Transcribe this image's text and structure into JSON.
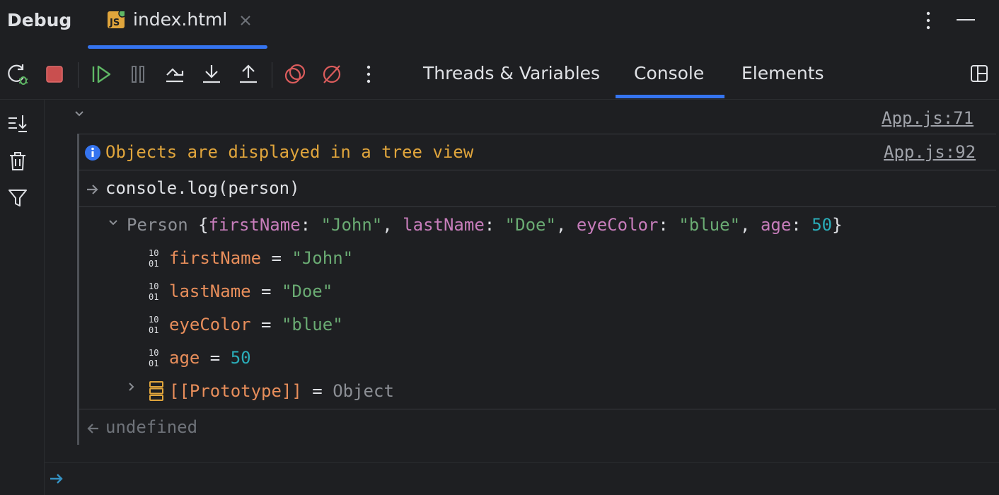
{
  "window": {
    "title": "Debug",
    "file_tab": {
      "label": "index.html",
      "icon": "js-file-icon"
    }
  },
  "toolbar": {
    "buttons": [
      {
        "name": "rerun-debug-icon"
      },
      {
        "name": "stop-icon",
        "color": "#db5c5c"
      },
      {
        "name": "resume-icon",
        "color": "#5fb865"
      },
      {
        "name": "pause-icon"
      },
      {
        "name": "step-over-icon"
      },
      {
        "name": "step-into-icon"
      },
      {
        "name": "step-out-icon"
      },
      {
        "name": "view-breakpoints-icon",
        "color": "#db5c5c"
      },
      {
        "name": "mute-breakpoints-icon",
        "color": "#db5c5c"
      },
      {
        "name": "more-icon"
      }
    ],
    "tabs": [
      {
        "label": "Threads & Variables",
        "active": false
      },
      {
        "label": "Console",
        "active": true
      },
      {
        "label": "Elements",
        "active": false
      }
    ],
    "accent": "#3574f0"
  },
  "gutter": {
    "buttons": [
      "scroll-to-end-icon",
      "clear-all-icon",
      "filter-icon"
    ]
  },
  "console": {
    "group_source": "App.js:71",
    "info": {
      "text": "Objects are displayed in a tree view",
      "source": "App.js:92"
    },
    "input": "console.log(person)",
    "object": {
      "type_name": "Person",
      "summary": [
        {
          "key": "firstName",
          "value": "\"John\""
        },
        {
          "key": "lastName",
          "value": "\"Doe\""
        },
        {
          "key": "eyeColor",
          "value": "\"blue\""
        },
        {
          "key": "age",
          "value": "50"
        }
      ],
      "properties": [
        {
          "name": "firstName",
          "value": "\"John\""
        },
        {
          "name": "lastName",
          "value": "\"Doe\""
        },
        {
          "name": "eyeColor",
          "value": "\"blue\""
        },
        {
          "name": "age",
          "value": "50"
        }
      ],
      "prototype": {
        "name": "[[Prototype]]",
        "value": "Object"
      }
    },
    "result": "undefined"
  },
  "colors": {
    "info": "#e0a53c",
    "key": "#c77dbb",
    "string": "#6aab73",
    "property": "#e88e5b",
    "number": "#2aacb8"
  }
}
